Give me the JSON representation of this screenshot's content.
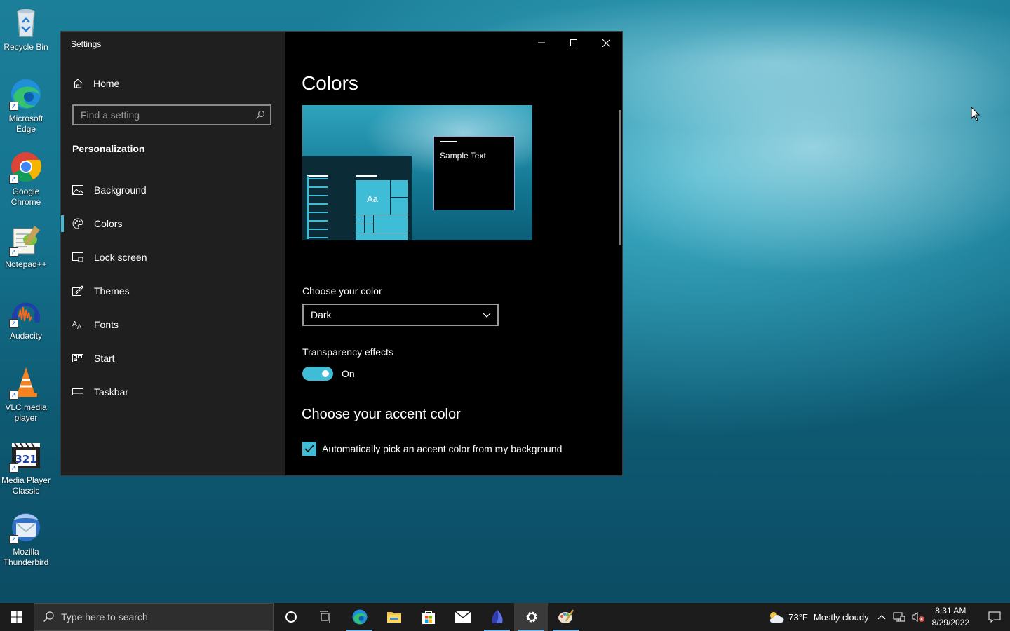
{
  "desktop": {
    "icons": [
      {
        "label": "Recycle Bin",
        "icon": "recycle-bin-icon"
      },
      {
        "label": "Microsoft\nEdge",
        "icon": "edge-icon"
      },
      {
        "label": "Google\nChrome",
        "icon": "chrome-icon"
      },
      {
        "label": "Notepad++",
        "icon": "notepadpp-icon"
      },
      {
        "label": "Audacity",
        "icon": "audacity-icon"
      },
      {
        "label": "VLC media\nplayer",
        "icon": "vlc-icon"
      },
      {
        "label": "Media Player\nClassic",
        "icon": "mpc-icon"
      },
      {
        "label": "Mozilla\nThunderbird",
        "icon": "thunderbird-icon"
      }
    ]
  },
  "window": {
    "title": "Settings",
    "accent_color": "#3fbcd6"
  },
  "sidebar": {
    "home_label": "Home",
    "search_placeholder": "Find a setting",
    "section_title": "Personalization",
    "items": [
      {
        "label": "Background",
        "icon": "picture-icon"
      },
      {
        "label": "Colors",
        "icon": "palette-icon",
        "active": true
      },
      {
        "label": "Lock screen",
        "icon": "lock-screen-icon"
      },
      {
        "label": "Themes",
        "icon": "themes-icon"
      },
      {
        "label": "Fonts",
        "icon": "fonts-icon"
      },
      {
        "label": "Start",
        "icon": "start-icon"
      },
      {
        "label": "Taskbar",
        "icon": "taskbar-icon"
      }
    ]
  },
  "content": {
    "title": "Colors",
    "preview_sample_text": "Sample Text",
    "preview_tile_text": "Aa",
    "choose_color_label": "Choose your color",
    "choose_color_value": "Dark",
    "transparency_label": "Transparency effects",
    "transparency_state": "On",
    "accent_title": "Choose your accent color",
    "auto_accent_label": "Automatically pick an accent color from my background",
    "auto_accent_checked": true
  },
  "taskbar": {
    "search_placeholder": "Type here to search",
    "weather_temp": "73°F",
    "weather_text": "Mostly cloudy",
    "time": "8:31 AM",
    "date": "8/29/2022"
  }
}
